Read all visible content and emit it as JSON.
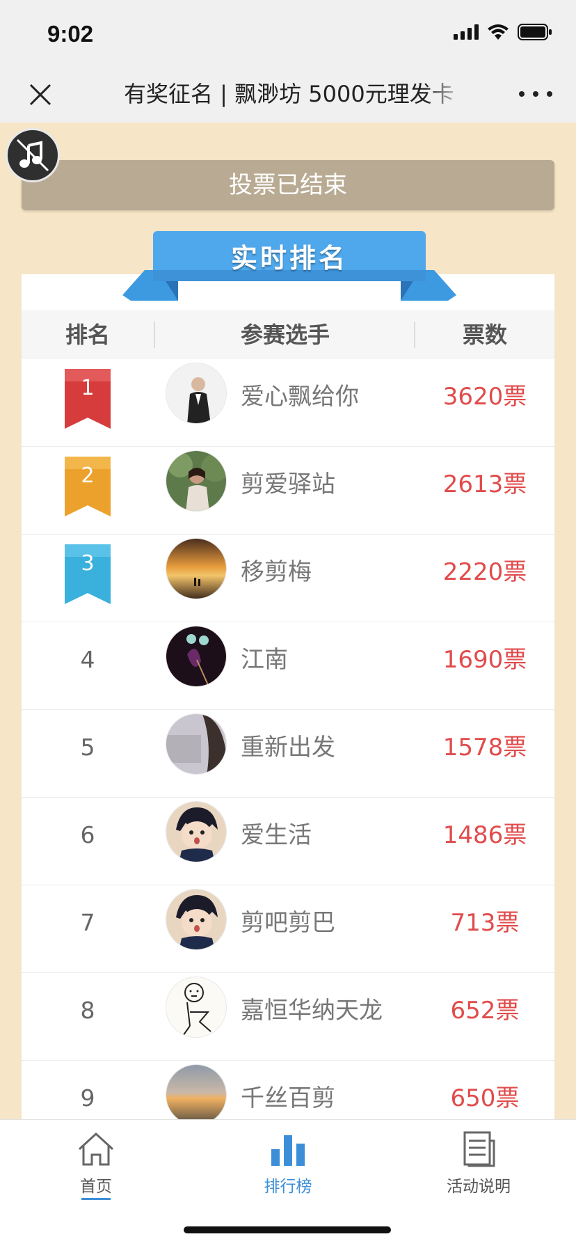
{
  "status_bar": {
    "time": "9:02",
    "icons": [
      "signal-icon",
      "wifi-icon",
      "battery-icon"
    ]
  },
  "nav": {
    "title": "有奖征名 | 飘渺坊 5000元理发卡",
    "close_icon": "close-icon",
    "more_icon": "more-icon"
  },
  "music": {
    "icon": "music-muted-icon"
  },
  "vote_status": "投票已结束",
  "ranking": {
    "title": "实时排名",
    "headers": {
      "rank": "排名",
      "player": "参赛选手",
      "votes": "票数"
    },
    "rows": [
      {
        "rank": "1",
        "name": "爱心飘给你",
        "votes": "3620票",
        "medal": "red"
      },
      {
        "rank": "2",
        "name": "剪爱驿站",
        "votes": "2613票",
        "medal": "gold"
      },
      {
        "rank": "3",
        "name": "移剪梅",
        "votes": "2220票",
        "medal": "blue"
      },
      {
        "rank": "4",
        "name": "江南",
        "votes": "1690票"
      },
      {
        "rank": "5",
        "name": "重新出发",
        "votes": "1578票"
      },
      {
        "rank": "6",
        "name": "爱生活",
        "votes": "1486票"
      },
      {
        "rank": "7",
        "name": "剪吧剪巴",
        "votes": "713票"
      },
      {
        "rank": "8",
        "name": "嘉恒华纳天龙",
        "votes": "652票"
      },
      {
        "rank": "9",
        "name": "千丝百剪",
        "votes": "650票"
      }
    ]
  },
  "tabs": [
    {
      "label": "首页",
      "icon": "home-icon"
    },
    {
      "label": "排行榜",
      "icon": "bar-chart-icon",
      "active": true
    },
    {
      "label": "活动说明",
      "icon": "document-icon"
    }
  ],
  "colors": {
    "page_bg": "#f6e5c6",
    "vote_red": "#e14b4b",
    "accent_blue": "#3d8ed9",
    "medal_red": "#d63c3c",
    "medal_gold": "#eca12c",
    "medal_blue": "#3ab0dd"
  }
}
